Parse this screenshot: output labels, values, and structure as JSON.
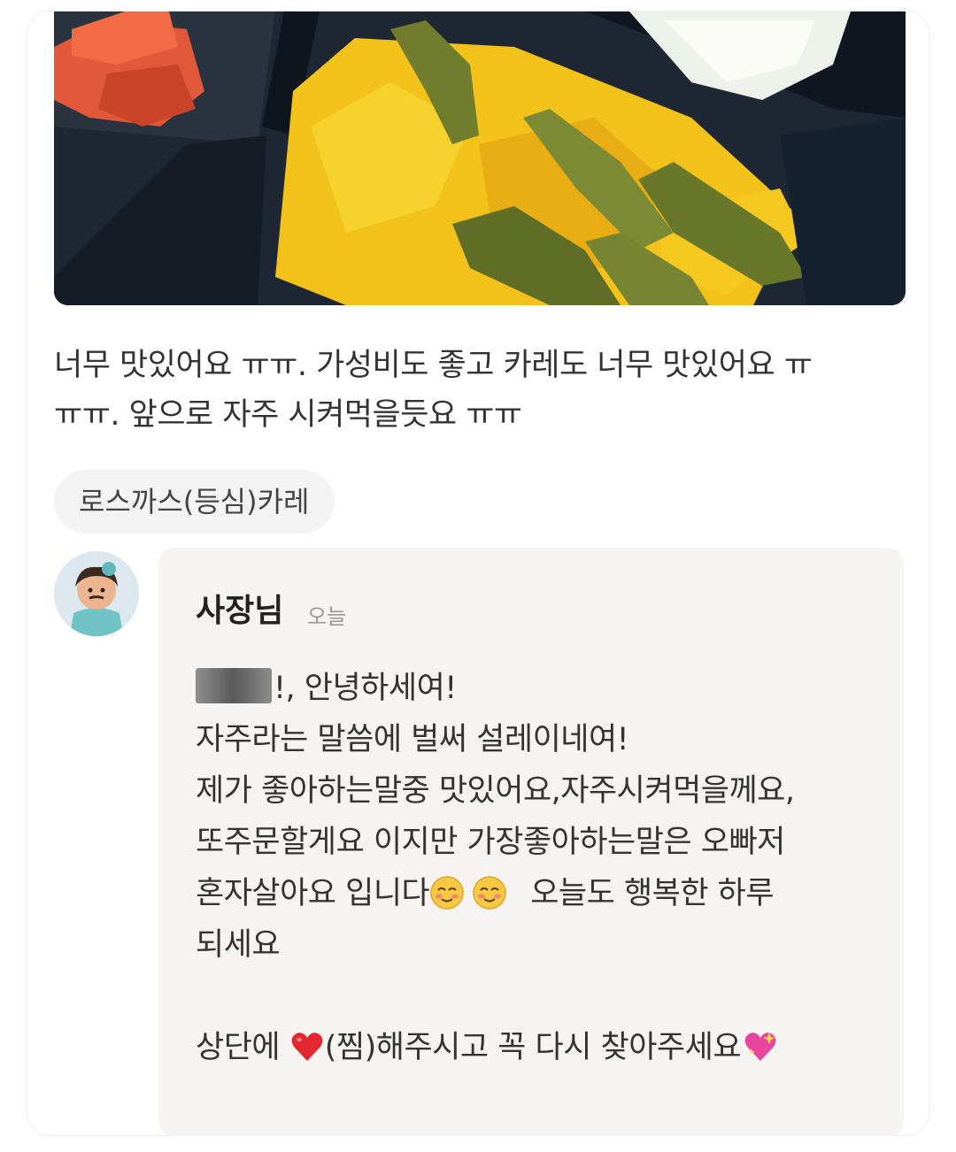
{
  "review": {
    "text_line1": "너무 맛있어요 ㅠㅠ. 가성비도 좋고 카레도 너무 맛있어요 ㅠ",
    "text_line2": "ㅠㅠ. 앞으로 자주 시켜먹을듯요 ㅠㅠ",
    "menu_tag": "로스까스(등심)카레"
  },
  "reply": {
    "owner_name": "사장님",
    "time": "오늘",
    "greeting_suffix": "!, 안녕하세여!",
    "line2": "자주라는 말씀에 벌써 설레이네여!",
    "line3": "제가 좋아하는말중 맛있어요,자주시켜먹을께요,",
    "line4": "또주문할게요 이지만 가장좋아하는말은 오빠저",
    "line5_a": "혼자살아요 입니다",
    "line5_b": "오늘도 행복한 하루",
    "line6": "되세요",
    "line7_a": "상단에",
    "line7_b": "(찜)해주시고 꼭 다시 찾아주세요"
  },
  "icons": {
    "blushing_emoji": "smiling-face-with-smiling-eyes",
    "heart_emoji": "red-heart",
    "sparkle_heart_emoji": "sparkling-heart"
  },
  "colors": {
    "reply_background": "#f5f4f2",
    "tag_background": "#f3f3f3",
    "time_text": "#999999"
  }
}
